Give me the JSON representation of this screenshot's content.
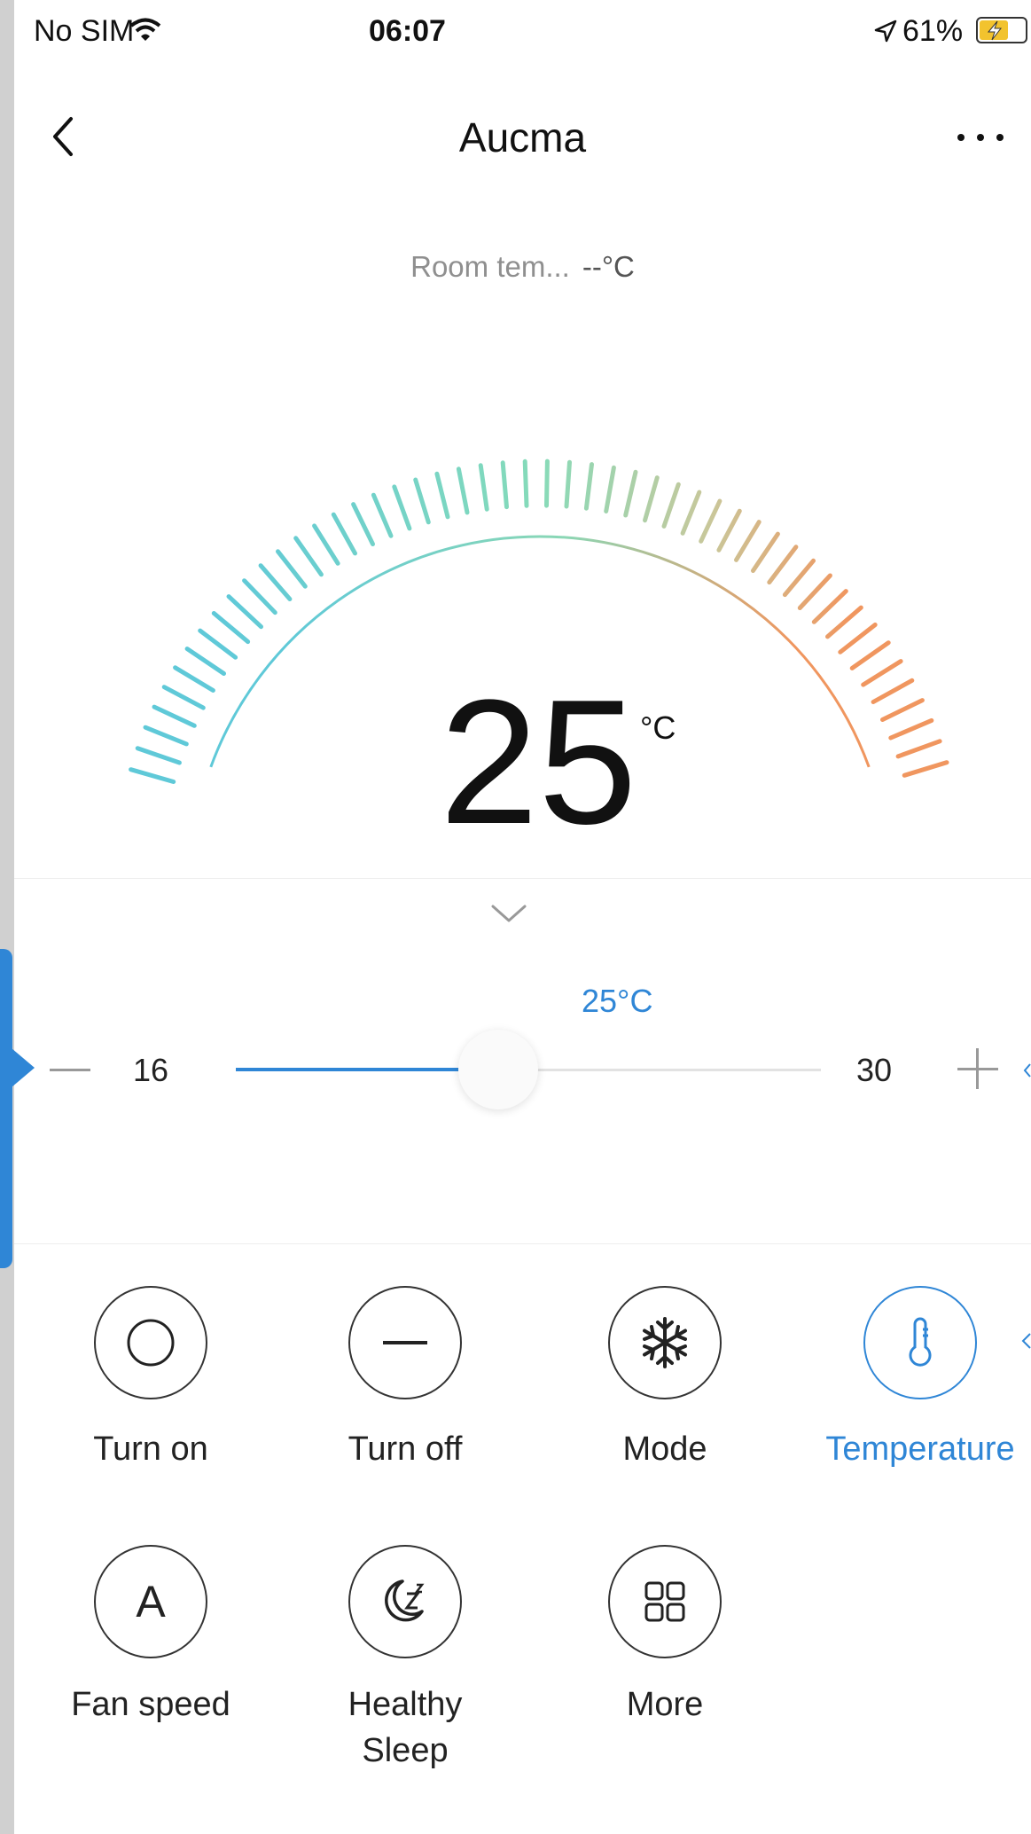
{
  "status_bar": {
    "carrier": "No SIM",
    "time": "06:07",
    "battery": "61%",
    "icons": [
      "wifi-icon",
      "location-arrow-icon",
      "battery-charging-icon"
    ]
  },
  "header": {
    "title": "Aucma",
    "back_icon": "chevron-left-icon",
    "more_icon": "more-horizontal-icon"
  },
  "room_temperature": {
    "label": "Room tem...",
    "value": "--°C"
  },
  "dial": {
    "temperature": "25",
    "unit": "°C",
    "colors": {
      "cool": "#5fc9d8",
      "mid": "#86dbb9",
      "warm": "#f0965f"
    }
  },
  "slider": {
    "current_label": "25°C",
    "min_label": "16",
    "max_label": "30",
    "min": 16,
    "max": 30,
    "value": 25,
    "accent": "#2f86d6"
  },
  "controls": [
    {
      "label": "Turn on",
      "icon": "power-circle-icon",
      "active": false
    },
    {
      "label": "Turn off",
      "icon": "minus-icon",
      "active": false
    },
    {
      "label": "Mode",
      "icon": "snowflake-icon",
      "active": false
    },
    {
      "label": "Temperature",
      "icon": "thermometer-icon",
      "active": true
    },
    {
      "label": "Fan speed",
      "icon": "fan-auto-icon",
      "active": false
    },
    {
      "label_line1": "Healthy",
      "label_line2": "Sleep",
      "icon": "sleep-moon-icon",
      "active": false
    },
    {
      "label": "More",
      "icon": "grid-icon",
      "active": false
    }
  ]
}
